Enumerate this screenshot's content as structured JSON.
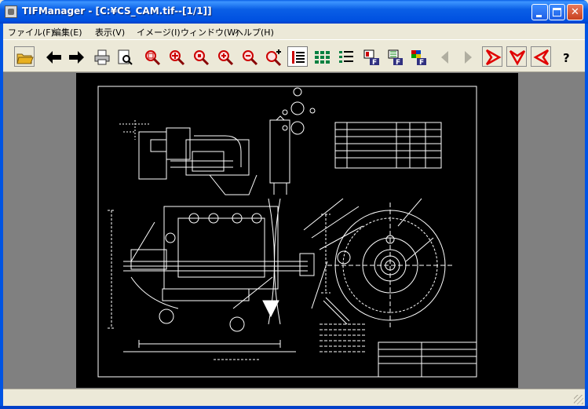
{
  "window": {
    "title": "TIFManager - [C:¥CS_CAM.tif--[1/1]]",
    "controls": {
      "minimize": "minimize-icon",
      "maximize": "maximize-icon",
      "close": "close-icon"
    }
  },
  "menu": [
    {
      "label": "ファイル(F)"
    },
    {
      "label": "編集(E)"
    },
    {
      "label": "表示(V)"
    },
    {
      "label": "イメージ(I)"
    },
    {
      "label": "ウィンドウ(W)"
    },
    {
      "label": "ヘルプ(H)"
    }
  ],
  "toolbar": [
    {
      "name": "open-folder-icon"
    },
    {
      "name": "previous-arrow-icon"
    },
    {
      "name": "next-arrow-icon"
    },
    {
      "name": "print-icon"
    },
    {
      "name": "print-preview-icon"
    },
    {
      "name": "zoom-area-icon"
    },
    {
      "name": "zoom-fit-icon"
    },
    {
      "name": "zoom-actual-icon"
    },
    {
      "name": "zoom-in-icon"
    },
    {
      "name": "zoom-out-icon"
    },
    {
      "name": "zoom-plus-icon"
    },
    {
      "name": "single-page-view-icon"
    },
    {
      "name": "thumbnail-grid-view-icon"
    },
    {
      "name": "list-view-icon"
    },
    {
      "name": "pdf-export-icon"
    },
    {
      "name": "pdf-convert-icon"
    },
    {
      "name": "pdf-color-icon"
    },
    {
      "name": "page-first-icon"
    },
    {
      "name": "page-last-icon"
    },
    {
      "name": "rotate-right-icon"
    },
    {
      "name": "flip-vertical-icon"
    },
    {
      "name": "rotate-left-icon"
    },
    {
      "name": "help-icon"
    }
  ],
  "colors": {
    "titlebar": "#0a5fe6",
    "chrome": "#ece9d8",
    "workspace": "#808080",
    "drawing_background": "#000000",
    "drawing_lines": "#ffffff",
    "toolbar_red": "#e00000"
  },
  "status": {
    "text": ""
  }
}
